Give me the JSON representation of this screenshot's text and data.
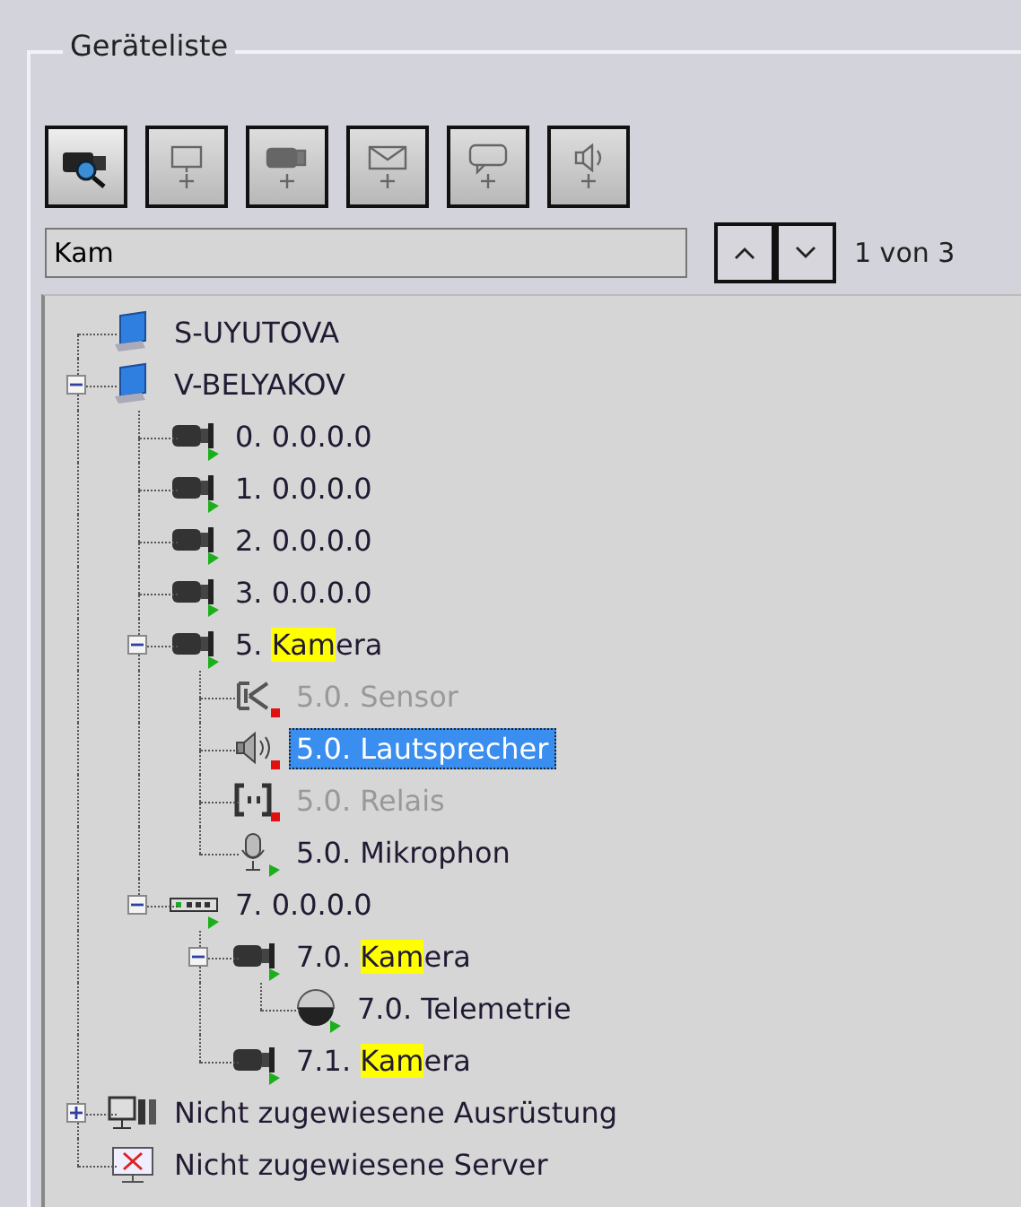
{
  "group": {
    "title": "Geräteliste"
  },
  "toolbar": [
    {
      "kind": "camera-search",
      "disabled": false
    },
    {
      "kind": "monitor-add",
      "disabled": true
    },
    {
      "kind": "camera-add",
      "disabled": true
    },
    {
      "kind": "mail-add",
      "disabled": true
    },
    {
      "kind": "sms-add",
      "disabled": true
    },
    {
      "kind": "speaker-add",
      "disabled": true
    }
  ],
  "search": {
    "value": "Kam",
    "counter": "1 von 3"
  },
  "tree": [
    {
      "kind": "computer",
      "label": "S-UYUTOVA",
      "selected": false,
      "disabled": false
    },
    {
      "kind": "computer",
      "label": "V-BELYAKOV",
      "expanded": true,
      "selected": false,
      "disabled": false,
      "children": [
        {
          "kind": "camera",
          "label": "0. 0.0.0.0",
          "online": true,
          "selected": false,
          "disabled": false
        },
        {
          "kind": "camera",
          "label": "1. 0.0.0.0",
          "online": true,
          "selected": false,
          "disabled": false
        },
        {
          "kind": "camera",
          "label": "2. 0.0.0.0",
          "online": true,
          "selected": false,
          "disabled": false
        },
        {
          "kind": "camera",
          "label": "3. 0.0.0.0",
          "online": true,
          "selected": false,
          "disabled": false
        },
        {
          "kind": "camera",
          "prefix": "5. ",
          "match": "Kam",
          "suffix": "era",
          "online": true,
          "expanded": true,
          "selected": false,
          "disabled": false,
          "children": [
            {
              "kind": "sensor",
              "label": "5.0. Sensor",
              "online": false,
              "selected": false,
              "disabled": true
            },
            {
              "kind": "speaker",
              "label": "5.0. Lautsprecher",
              "online": false,
              "selected": true,
              "disabled": false
            },
            {
              "kind": "relay",
              "label": "5.0. Relais",
              "online": false,
              "selected": false,
              "disabled": true
            },
            {
              "kind": "microphone",
              "label": "5.0. Mikrophon",
              "online": true,
              "selected": false,
              "disabled": false
            }
          ]
        },
        {
          "kind": "device",
          "label": "7. 0.0.0.0",
          "online": true,
          "expanded": true,
          "selected": false,
          "disabled": false,
          "children": [
            {
              "kind": "camera",
              "prefix": "7.0. ",
              "match": "Kam",
              "suffix": "era",
              "online": true,
              "expanded": true,
              "selected": false,
              "disabled": false,
              "children": [
                {
                  "kind": "telemetry",
                  "label": "7.0. Telemetrie",
                  "online": true,
                  "selected": false,
                  "disabled": false
                }
              ]
            },
            {
              "kind": "camera",
              "prefix": "7.1. ",
              "match": "Kam",
              "suffix": "era",
              "online": true,
              "selected": false,
              "disabled": false
            }
          ]
        }
      ]
    },
    {
      "kind": "equipment",
      "label": "Nicht zugewiesene Ausrüstung",
      "expanded": false,
      "selected": false,
      "disabled": false
    },
    {
      "kind": "server",
      "label": "Nicht zugewiesene Server",
      "selected": false,
      "disabled": false
    }
  ]
}
